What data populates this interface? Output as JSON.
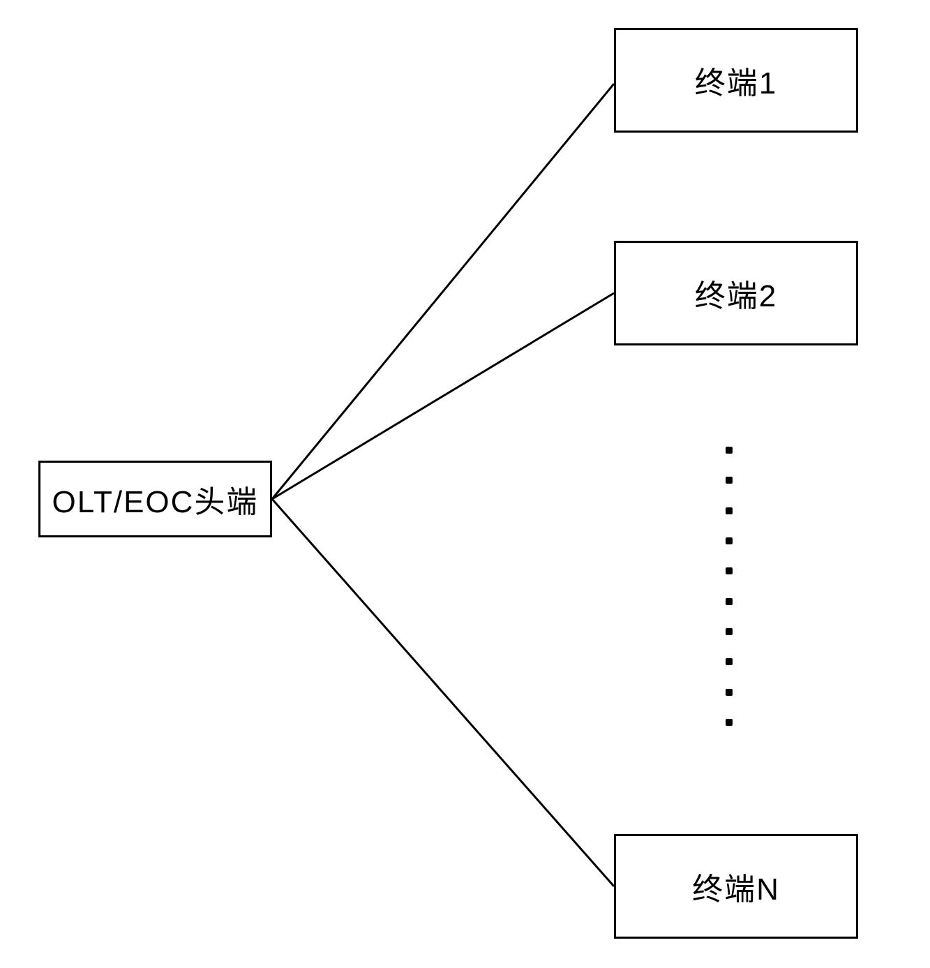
{
  "diagram": {
    "head_end": {
      "label": "OLT/EOC头端"
    },
    "terminals": {
      "t1": {
        "label": "终端1"
      },
      "t2": {
        "label": "终端2"
      },
      "tn": {
        "label": "终端N"
      }
    },
    "ellipsis_count": 10
  },
  "chart_data": {
    "type": "diagram",
    "title": "",
    "description": "Network topology showing OLT/EOC head-end connected to N terminals",
    "nodes": [
      {
        "id": "head",
        "label": "OLT/EOC头端",
        "role": "head-end"
      },
      {
        "id": "t1",
        "label": "终端1",
        "role": "terminal"
      },
      {
        "id": "t2",
        "label": "终端2",
        "role": "terminal"
      },
      {
        "id": "ellipsis",
        "label": "...",
        "role": "ellipsis"
      },
      {
        "id": "tn",
        "label": "终端N",
        "role": "terminal"
      }
    ],
    "edges": [
      {
        "from": "head",
        "to": "t1"
      },
      {
        "from": "head",
        "to": "t2"
      },
      {
        "from": "head",
        "to": "tn"
      }
    ]
  }
}
